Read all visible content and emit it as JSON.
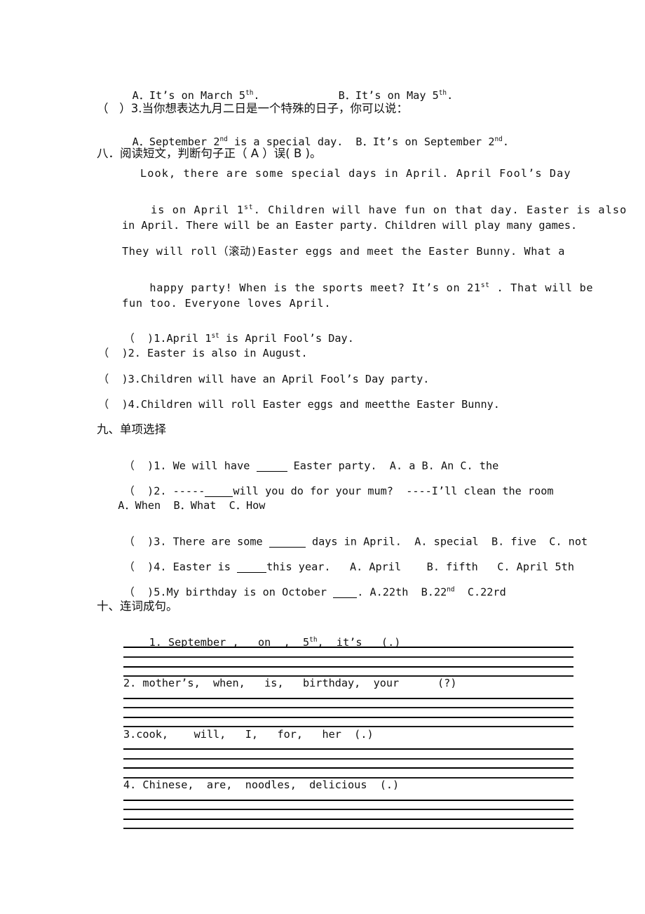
{
  "document": {
    "type": "worksheet",
    "language": "zh-CN/en"
  },
  "top_fragment": {
    "choices_line": "A．It’s on March 5th.           B．It’s on May 5th.",
    "choices_a_prefix": "A．It’s on March 5",
    "choices_a_sup": "th",
    "choices_a_suffix": ".",
    "choices_b_prefix": "B．It’s on May 5",
    "choices_b_sup": "th",
    "choices_b_suffix": ".",
    "question3_stem": "（   ）3.当你想表达九月二日是一个特殊的日子，你可以说：",
    "question3_a_prefix": "A．September 2",
    "question3_a_sup": "nd",
    "question3_a_suffix": " is a special day.",
    "question3_b_prefix": "B．It’s on September 2",
    "question3_b_sup": "nd",
    "question3_b_suffix": "."
  },
  "section8": {
    "heading": "八．阅读短文，判断句子正（ A ）误( B )。",
    "passage": [
      "Look, there are some special days in April. April Fool’s Day",
      "is on April 1|st|. Children will have fun on that day. Easter is also",
      "in April. There will be an Easter party. Children will play many games.",
      "They will roll（滚动)Easter eggs and meet the Easter Bunny. What a",
      "happy party! When is the sports meet? It’s on 21|st| . That will be",
      "fun too. Everyone loves April."
    ],
    "passage_lines": [
      {
        "text": "Look, there are some special days in April. April Fool’s Day",
        "indent": 62,
        "sup_after": "",
        "sup": ""
      },
      {
        "pre": "is on April 1",
        "sup": "st",
        "post": ". Children will have fun on that day. Easter is also",
        "indent": 36
      },
      {
        "pre": "in April. There will be an Easter party. Children will play many games.",
        "sup": "",
        "post": "",
        "indent": 36
      },
      {
        "pre": "They will roll（滚动)Easter eggs and meet the Easter Bunny. What a",
        "sup": "",
        "post": "",
        "indent": 36
      },
      {
        "pre": "happy party! When is the sports meet? It’s on 21",
        "sup": "st",
        "post": " . That will be",
        "indent": 36
      },
      {
        "pre": "fun too. Everyone loves April.",
        "sup": "",
        "post": "",
        "indent": 36
      }
    ],
    "tf_items": [
      {
        "pre": "（  )1.April 1",
        "sup": "st",
        "post": " is April Fool’s Day."
      },
      {
        "pre": "（  )2. Easter is also in August.",
        "sup": "",
        "post": ""
      },
      {
        "pre": "（  )3.Children will have an April Fool’s Day party.",
        "sup": "",
        "post": ""
      },
      {
        "pre": "（  )4.Children will roll Easter eggs and meetthe Easter Bunny.",
        "sup": "",
        "post": ""
      }
    ]
  },
  "section9": {
    "heading": "九、单项选择",
    "items": [
      {
        "pre": "（  )1. We will have ",
        "blank_width": 44,
        "post": " Easter party.  A. a B. An C. the",
        "sup": "",
        "tail": ""
      },
      {
        "pre": "（  )2. -----",
        "blank_width": 40,
        "post": "will you do for your mum?  ----I’ll clean the room",
        "sup": "",
        "tail": ""
      }
    ],
    "item2_options": "  A．When  B．What  C．How",
    "item3": {
      "pre": "（  )3. There are some ",
      "blank_width": 52,
      "post": " days in April.  A. special  B. five  C. not"
    },
    "item4": {
      "pre": "（  )4. Easter is ",
      "blank_width": 42,
      "post": "this year.   A. April    B. fifth   C. April 5th"
    },
    "item5": {
      "pre": "（  )5.My birthday is on October ",
      "blank_width": 34,
      "post": ". A.22th  B.22",
      "sup": "nd",
      "tail": "  C.22rd"
    }
  },
  "section10": {
    "heading": "十、连词成句。",
    "items": [
      {
        "pre": "1. September ,   on  ,  5",
        "sup": "th",
        "post": ",  it’s   (.)"
      },
      {
        "pre": "2. mother’s,  when,   is,   birthday,  your      (?)",
        "sup": "",
        "post": ""
      },
      {
        "pre": "3.cook,    will,   I,   for,   her  (.)",
        "sup": "",
        "post": ""
      },
      {
        "pre": "4. Chinese,  are,  noodles,  delicious  (.)",
        "sup": "",
        "post": ""
      }
    ]
  }
}
